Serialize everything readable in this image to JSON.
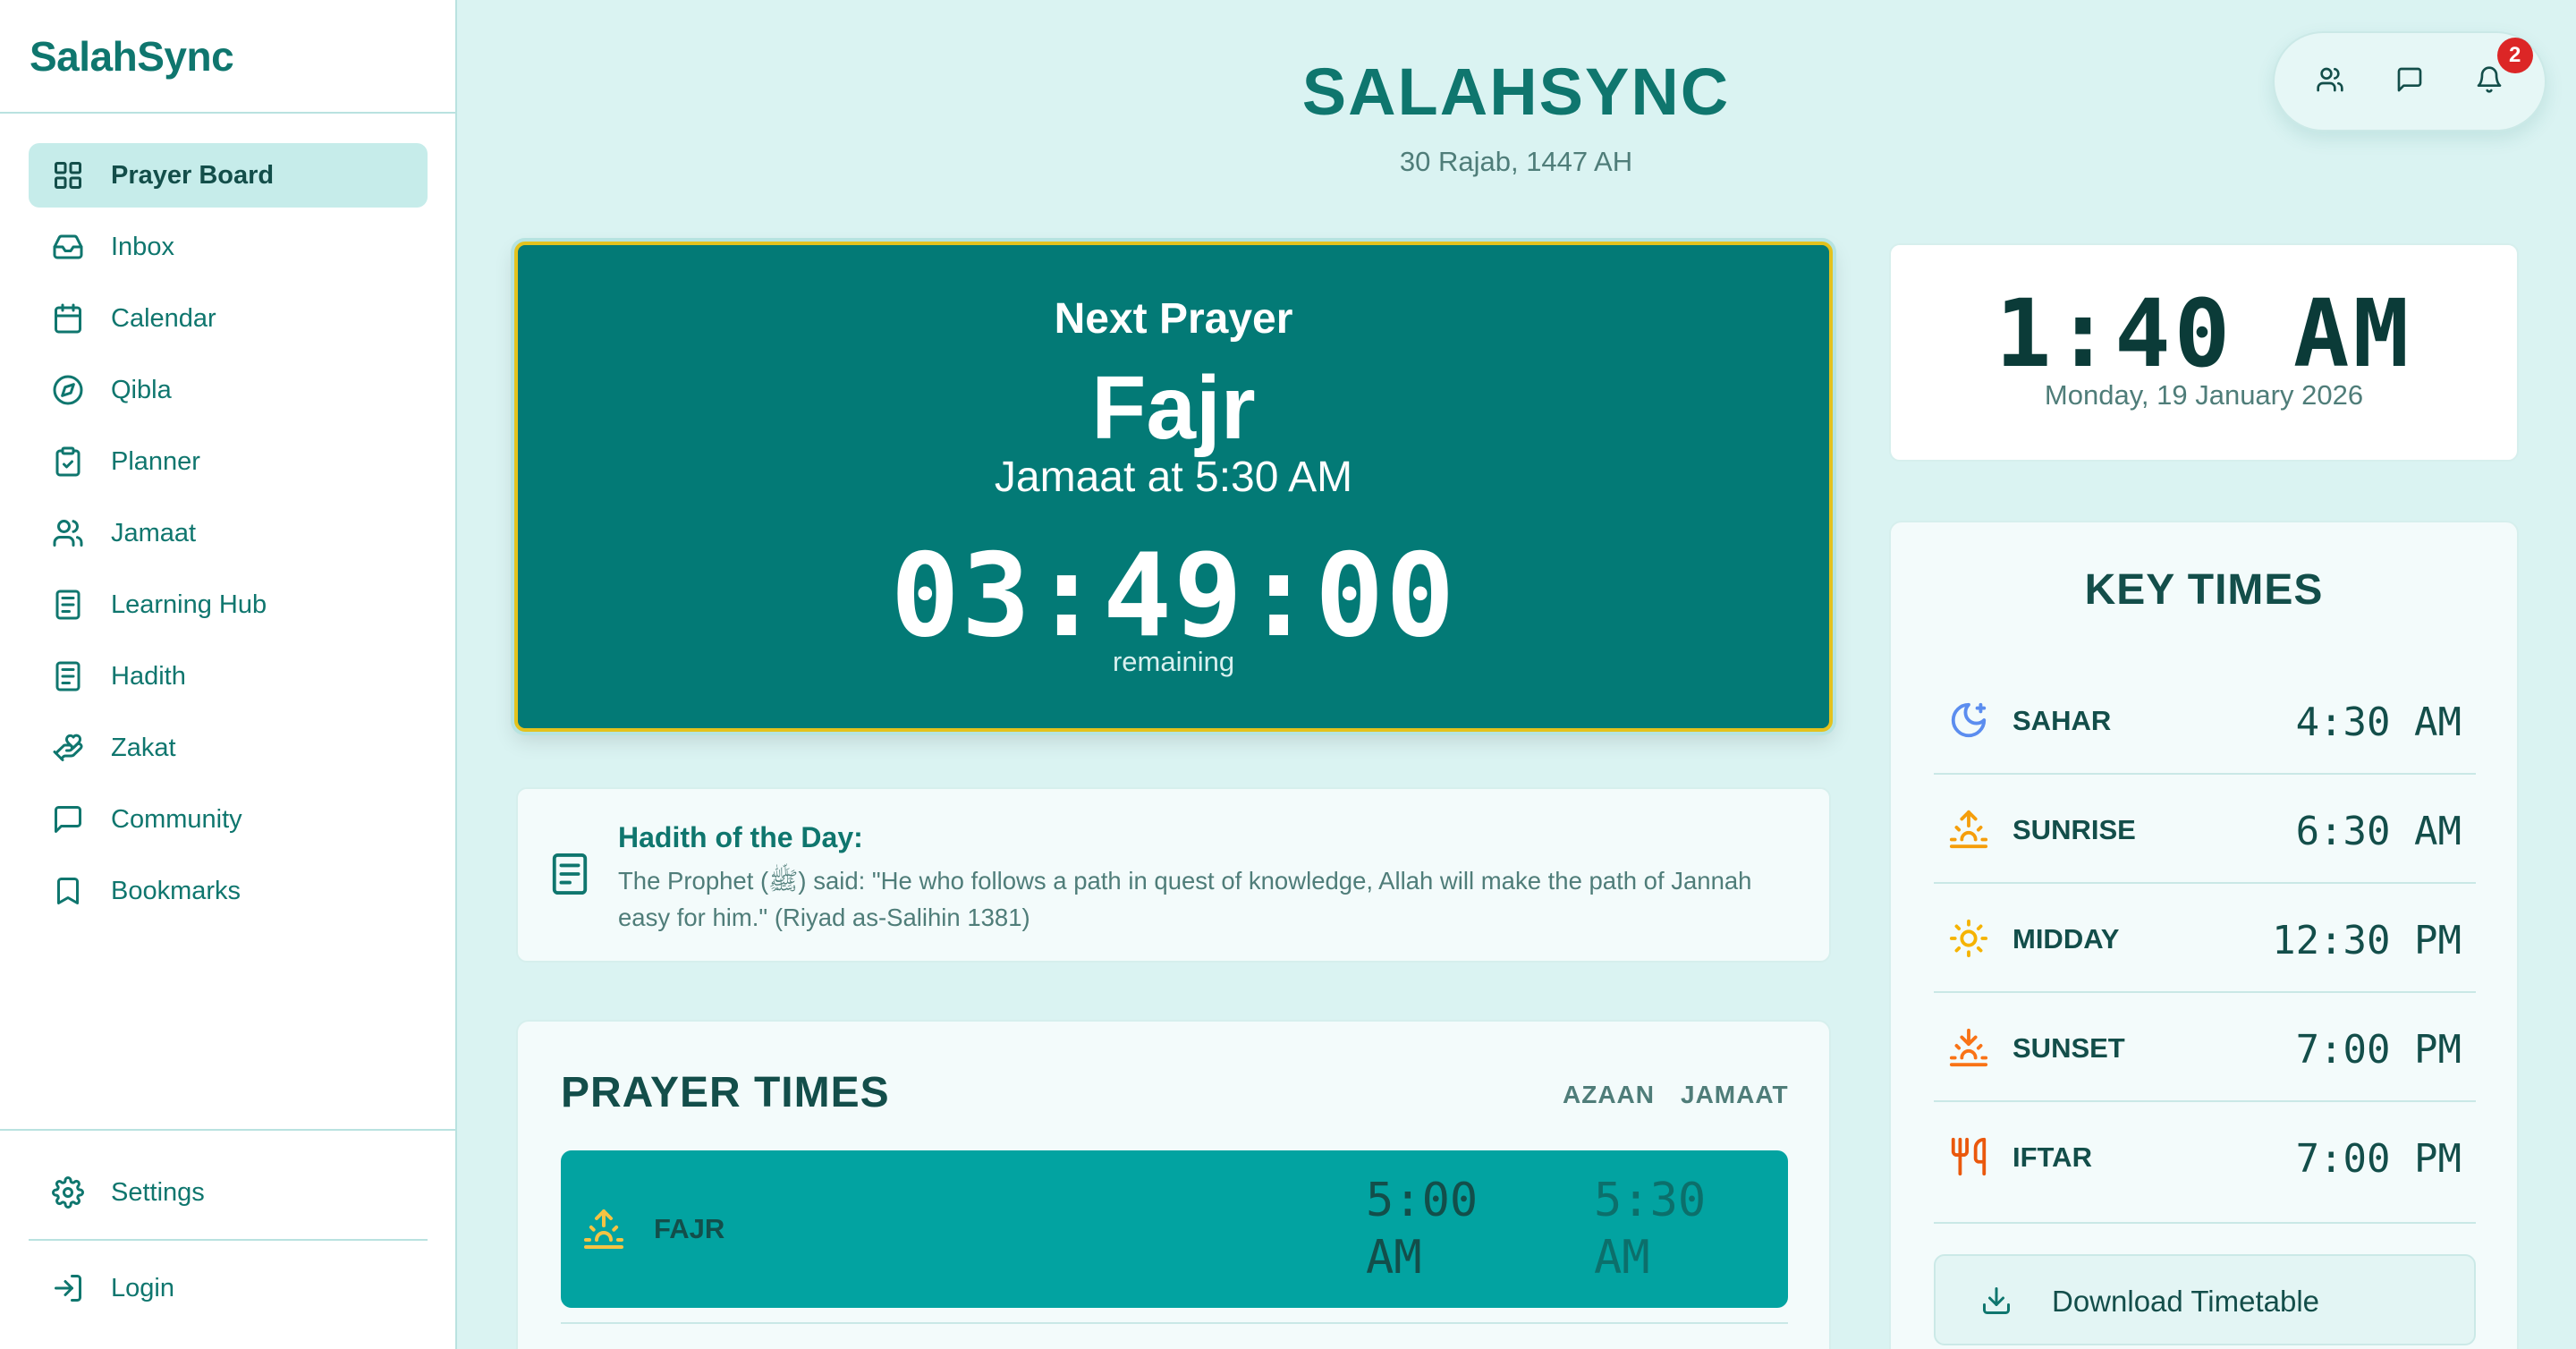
{
  "brand": "SalahSync",
  "sidebar": {
    "items": [
      {
        "label": "Prayer Board",
        "icon": "grid-icon"
      },
      {
        "label": "Inbox",
        "icon": "inbox-icon"
      },
      {
        "label": "Calendar",
        "icon": "calendar-icon"
      },
      {
        "label": "Qibla",
        "icon": "compass-icon"
      },
      {
        "label": "Planner",
        "icon": "clipboard-check-icon"
      },
      {
        "label": "Jamaat",
        "icon": "users-icon"
      },
      {
        "label": "Learning Hub",
        "icon": "document-icon"
      },
      {
        "label": "Hadith",
        "icon": "document-icon"
      },
      {
        "label": "Zakat",
        "icon": "hand-heart-icon"
      },
      {
        "label": "Community",
        "icon": "message-square-icon"
      },
      {
        "label": "Bookmarks",
        "icon": "bookmark-icon"
      }
    ],
    "active_index": 0,
    "settings_label": "Settings",
    "login_label": "Login"
  },
  "header": {
    "title": "SALAHSYNC",
    "hijri_date": "30 Rajab, 1447 AH",
    "actions": [
      "users-icon",
      "message-square-icon",
      "bell-icon"
    ],
    "notification_count": "2"
  },
  "next_prayer": {
    "heading": "Next Prayer",
    "name": "Fajr",
    "jamaat": "Jamaat at 5:30 AM",
    "countdown": "03:49:00",
    "remaining_label": "remaining"
  },
  "hadith": {
    "title": "Hadith of the Day:",
    "text": "The Prophet (ﷺ) said: \"He who follows a path in quest of knowledge, Allah will make the path of Jannah easy for him.\" (Riyad as-Salihin 1381)"
  },
  "prayer_times": {
    "title": "PRAYER TIMES",
    "columns": {
      "azaan": "AZAAN",
      "jamaat": "JAMAAT"
    },
    "rows": [
      {
        "name": "FAJR",
        "azaan": "5:00 AM",
        "jamaat": "5:30 AM",
        "icon": "sunrise-icon"
      }
    ]
  },
  "clock": {
    "time": "1:40 AM",
    "date": "Monday, 19 January 2026"
  },
  "key_times": {
    "title": "KEY TIMES",
    "rows": [
      {
        "label": "SAHAR",
        "time": "4:30 AM",
        "icon": "moon-star-icon",
        "color": "#5b8def"
      },
      {
        "label": "SUNRISE",
        "time": "6:30 AM",
        "icon": "sunrise-icon",
        "color": "#f59e0b"
      },
      {
        "label": "MIDDAY",
        "time": "12:30 PM",
        "icon": "sun-icon",
        "color": "#f5b301"
      },
      {
        "label": "SUNSET",
        "time": "7:00 PM",
        "icon": "sunset-icon",
        "color": "#f97316"
      },
      {
        "label": "IFTAR",
        "time": "7:00 PM",
        "icon": "utensils-icon",
        "color": "#ea580c"
      }
    ],
    "download_label": "Download Timetable"
  },
  "colors": {
    "accent": "#0f766e",
    "card_teal": "#037a76",
    "highlight_row": "#02a3a1",
    "border_gold": "#e4c21d",
    "badge": "#dc2626"
  }
}
